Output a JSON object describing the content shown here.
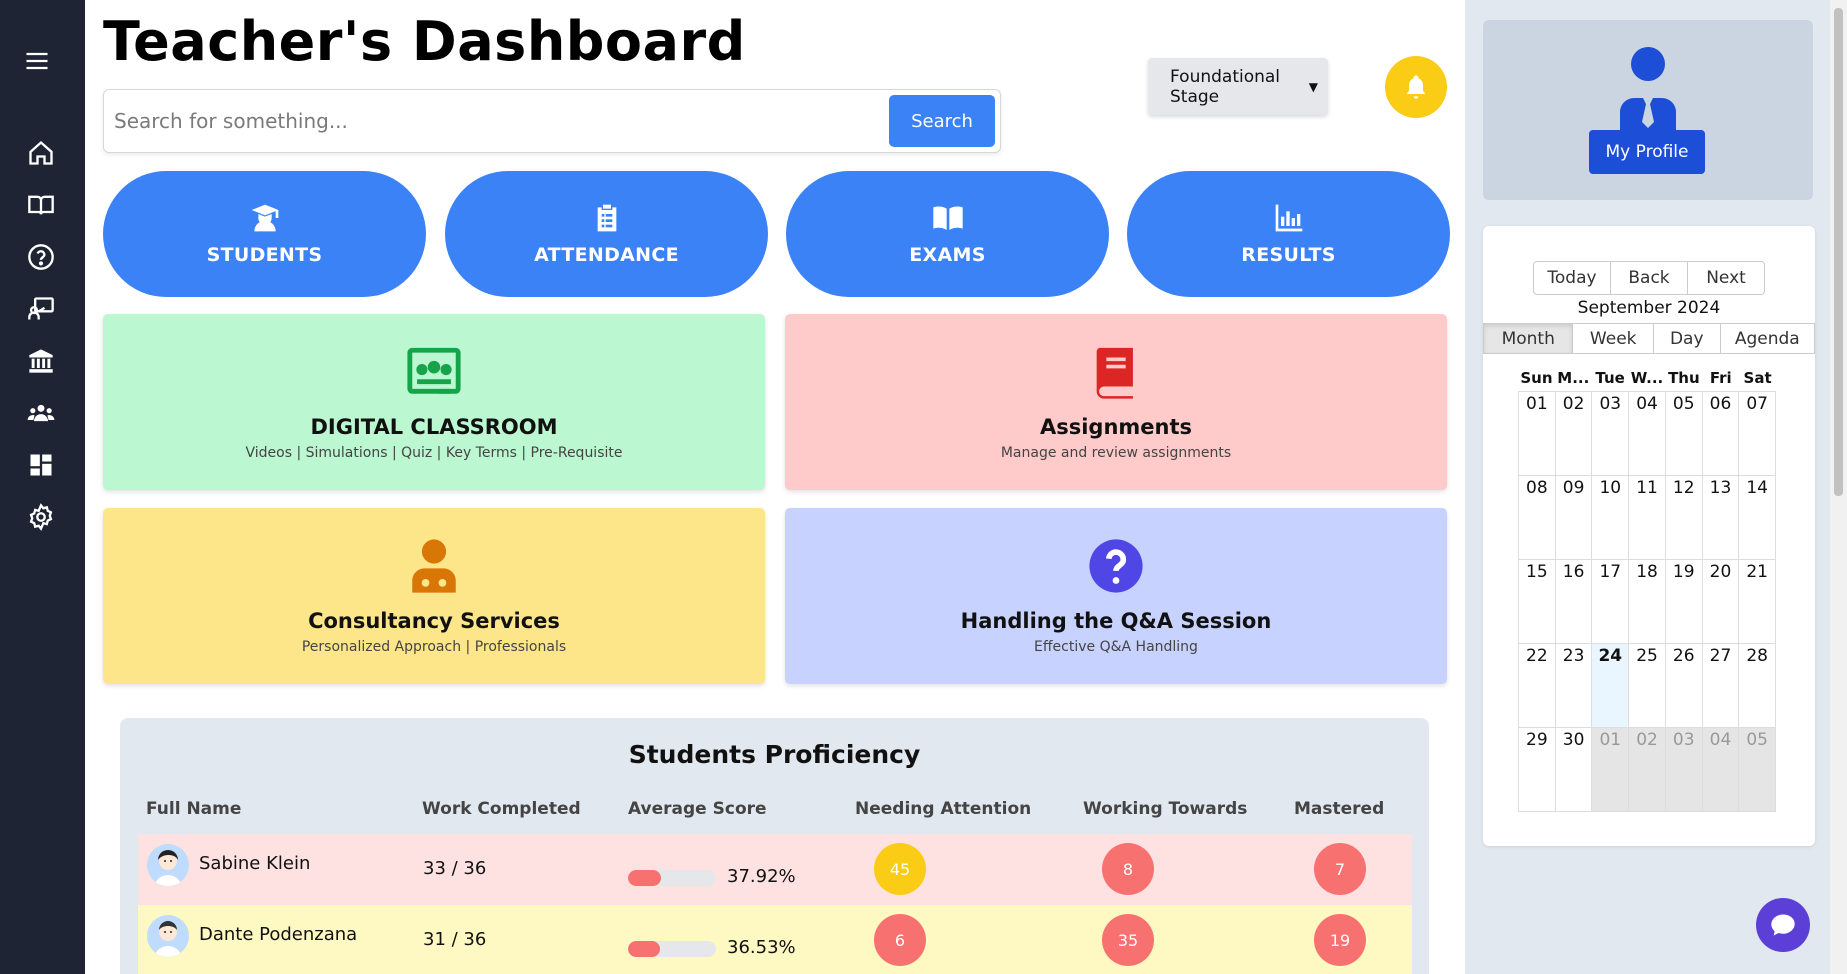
{
  "header": {
    "title": "Teacher's Dashboard",
    "search_placeholder": "Search for something...",
    "search_button": "Search",
    "stage_selected": "Foundational Stage"
  },
  "sidebar": {
    "icons": [
      "menu-icon",
      "home-icon",
      "book-icon",
      "help-icon",
      "teacher-icon",
      "institution-icon",
      "users-icon",
      "dashboard-icon",
      "settings-icon"
    ]
  },
  "nav_buttons": [
    {
      "label": "STUDENTS",
      "icon": "graduate-icon"
    },
    {
      "label": "ATTENDANCE",
      "icon": "clipboard-icon"
    },
    {
      "label": "EXAMS",
      "icon": "open-book-icon"
    },
    {
      "label": "RESULTS",
      "icon": "chart-icon"
    }
  ],
  "cards": [
    {
      "title": "DIGITAL CLASSROOM",
      "subtitle": "Videos | Simulations | Quiz | Key Terms | Pre-Requisite",
      "color": "#bbf7d0",
      "icon_color": "#16a34a"
    },
    {
      "title": "Assignments",
      "subtitle": "Manage and review assignments",
      "color": "#fecaca",
      "icon_color": "#dc2626"
    },
    {
      "title": "Consultancy Services",
      "subtitle": "Personalized Approach | Professionals",
      "color": "#fde68a",
      "icon_color": "#d97706"
    },
    {
      "title": "Handling the Q&A Session",
      "subtitle": "Effective Q&A Handling",
      "color": "#c7d2fe",
      "icon_color": "#4f46e5"
    }
  ],
  "proficiency": {
    "title": "Students Proficiency",
    "headers": [
      "Full Name",
      "Work Completed",
      "Average Score",
      "Needing Attention",
      "Working Towards",
      "Mastered"
    ],
    "rows": [
      {
        "name": "Sabine Klein",
        "work": "33 / 36",
        "score": "37.92%",
        "score_value": 0.3792,
        "needing": "45",
        "working": "8",
        "mastered": "7",
        "row_color": "#fee2e2",
        "needing_color": "#facc15"
      },
      {
        "name": "Dante Podenzana",
        "work": "31 / 36",
        "score": "36.53%",
        "score_value": 0.3653,
        "needing": "6",
        "working": "35",
        "mastered": "19",
        "row_color": "#fef9c3",
        "needing_color": "#f87171"
      }
    ]
  },
  "profile": {
    "button": "My Profile"
  },
  "calendar": {
    "nav": [
      "Today",
      "Back",
      "Next"
    ],
    "label": "September 2024",
    "views": [
      "Month",
      "Week",
      "Day",
      "Agenda"
    ],
    "active_view": "Month",
    "weekdays": [
      "Sun",
      "M...",
      "Tue",
      "W...",
      "Thu",
      "Fri",
      "Sat"
    ],
    "weeks": [
      [
        "01",
        "02",
        "03",
        "04",
        "05",
        "06",
        "07"
      ],
      [
        "08",
        "09",
        "10",
        "11",
        "12",
        "13",
        "14"
      ],
      [
        "15",
        "16",
        "17",
        "18",
        "19",
        "20",
        "21"
      ],
      [
        "22",
        "23",
        "24",
        "25",
        "26",
        "27",
        "28"
      ],
      [
        "29",
        "30",
        "01",
        "02",
        "03",
        "04",
        "05"
      ]
    ],
    "today": "24"
  },
  "colors": {
    "accent": "#3b82f6",
    "sidebar": "#1e2433",
    "bell": "#facc15",
    "profile_button": "#1d4ed8",
    "chat": "#5b3fd6"
  }
}
